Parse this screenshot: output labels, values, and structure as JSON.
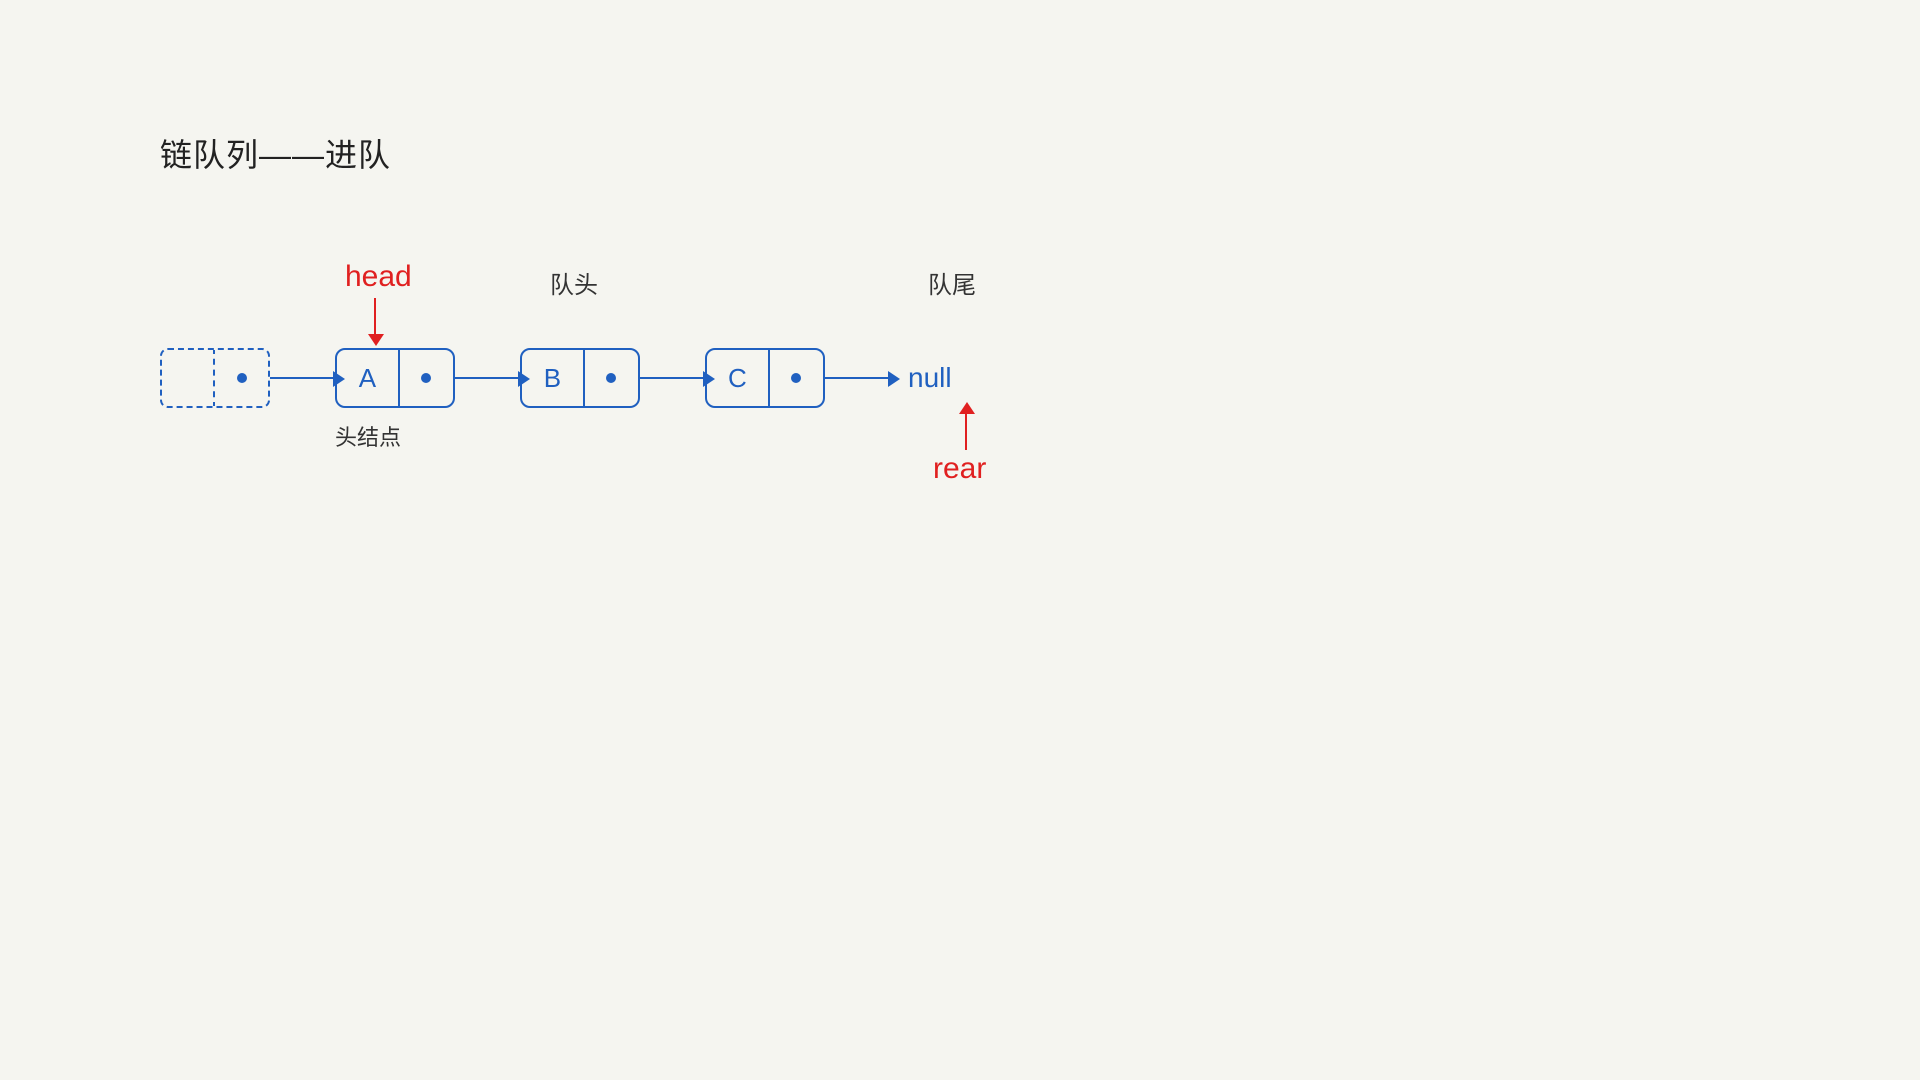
{
  "title": "链队列——进队",
  "diagram": {
    "head_label": "head",
    "rear_label": "rear",
    "queue_head_label": "队头",
    "queue_tail_label": "队尾",
    "head_node_label": "头结点",
    "null_label": "null",
    "nodes": [
      {
        "letter": "A"
      },
      {
        "letter": "B"
      },
      {
        "letter": "C"
      }
    ]
  }
}
